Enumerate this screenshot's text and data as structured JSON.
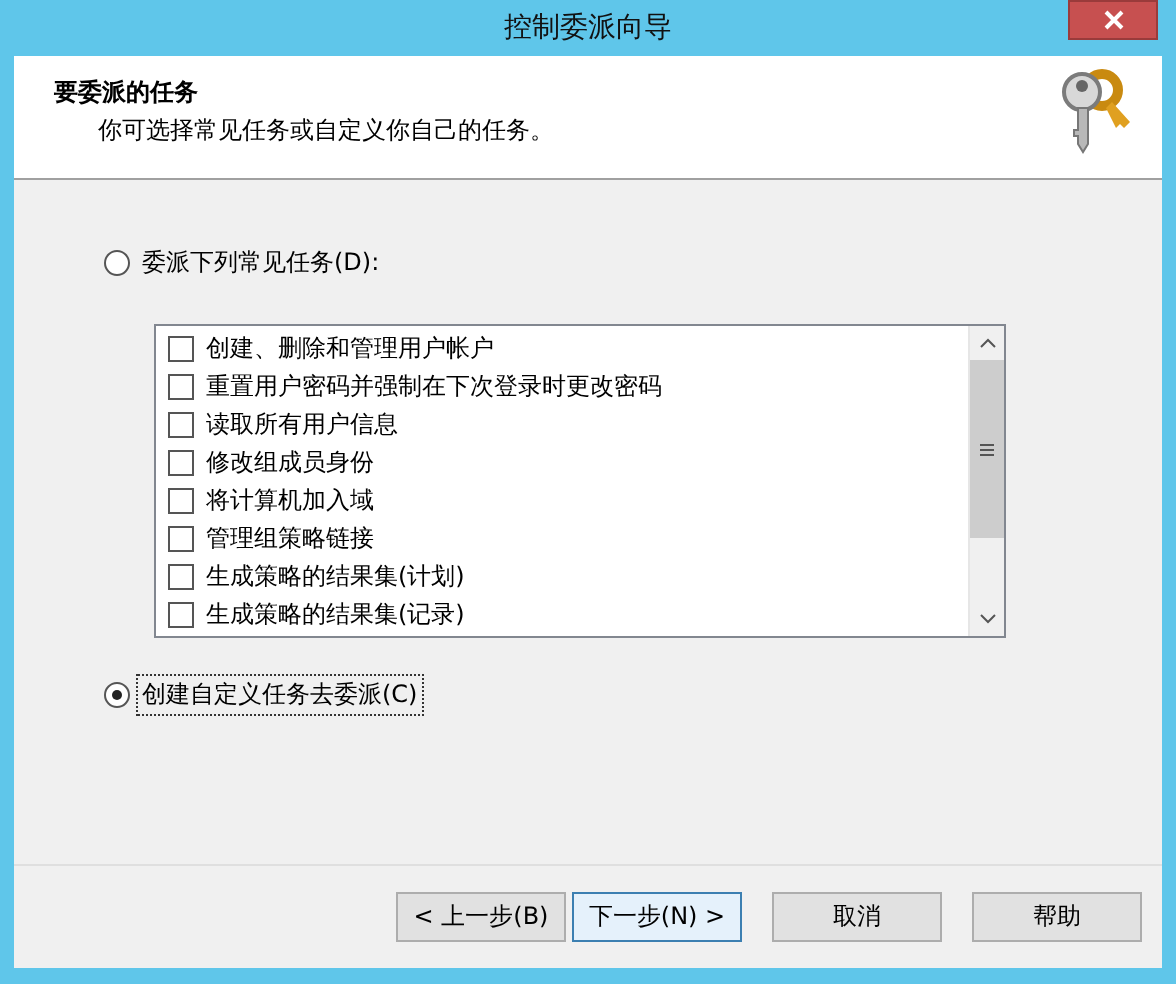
{
  "window": {
    "title": "控制委派向导"
  },
  "header": {
    "title": "要委派的任务",
    "subtitle": "你可选择常见任务或自定义你自己的任务。"
  },
  "options": [
    {
      "label": "委派下列常见任务(D):",
      "selected": false,
      "kind": "list"
    },
    {
      "label": "创建自定义任务去委派(C)",
      "selected": true,
      "kind": "plain"
    }
  ],
  "tasks": [
    {
      "label": "创建、删除和管理用户帐户",
      "checked": false
    },
    {
      "label": "重置用户密码并强制在下次登录时更改密码",
      "checked": false
    },
    {
      "label": "读取所有用户信息",
      "checked": false
    },
    {
      "label": "修改组成员身份",
      "checked": false
    },
    {
      "label": "将计算机加入域",
      "checked": false
    },
    {
      "label": "管理组策略链接",
      "checked": false
    },
    {
      "label": "生成策略的结果集(计划)",
      "checked": false
    },
    {
      "label": "生成策略的结果集(记录)",
      "checked": false
    }
  ],
  "buttons": [
    {
      "label": "< 上一步(B)",
      "default": false
    },
    {
      "label": "下一步(N) >",
      "default": true
    },
    {
      "label": "取消",
      "default": false
    },
    {
      "label": "帮助",
      "default": false
    }
  ]
}
